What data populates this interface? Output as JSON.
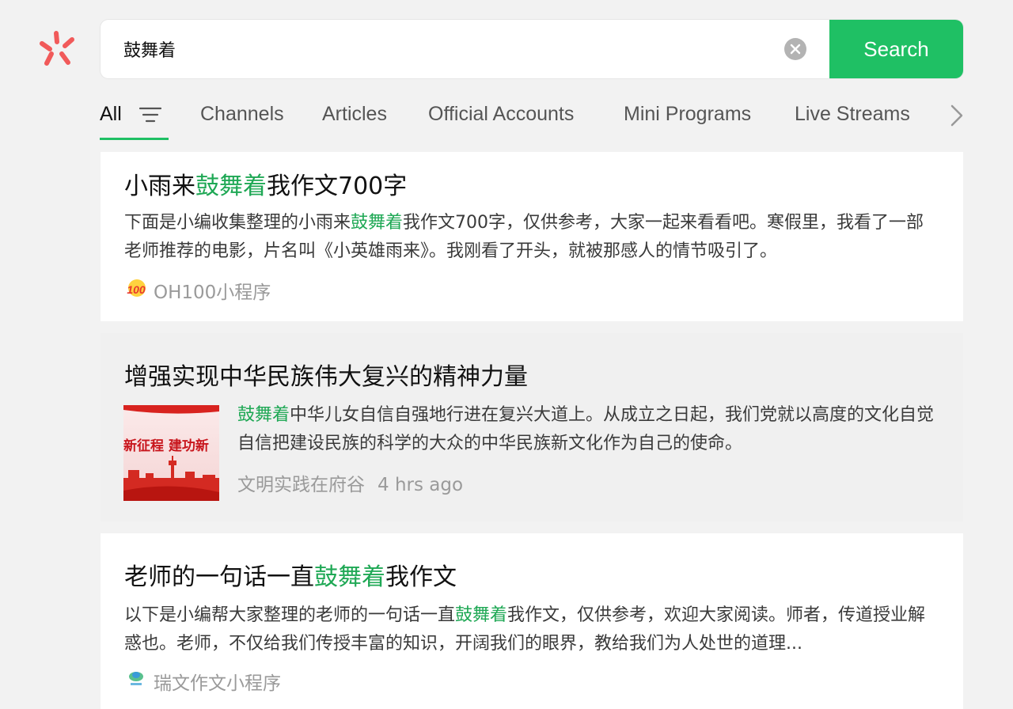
{
  "search": {
    "query": "鼓舞着",
    "button_label": "Search"
  },
  "tabs": [
    {
      "label": "All"
    },
    {
      "label": "Channels"
    },
    {
      "label": "Articles"
    },
    {
      "label": "Official Accounts"
    },
    {
      "label": "Mini Programs"
    },
    {
      "label": "Live Streams"
    }
  ],
  "results": [
    {
      "title_pre": "小雨来",
      "title_hl": "鼓舞着",
      "title_post": "我作文700字",
      "desc_pre": "下面是小编收集整理的小雨来",
      "desc_hl": "鼓舞着",
      "desc_post": "我作文700字，仅供参考，大家一起来看看吧。寒假里，我看了一部老师推荐的电影，片名叫《小英雄雨来》。我刚看了开头，就被那感人的情节吸引了。",
      "source": "OH100小程序",
      "source_icon_text": "100"
    },
    {
      "title": "增强实现中华民族伟大复兴的精神力量",
      "desc_hl": "鼓舞着",
      "desc_post": "中华儿女自信自强地行进在复兴大道上。从成立之日起，我们党就以高度的文化自觉自信把建设民族的科学的大众的中华民族新文化作为自己的使命。",
      "source": "文明实践在府谷",
      "time": "4 hrs ago",
      "thumb_text": "新征程  建功新"
    },
    {
      "title_pre": "老师的一句话一直",
      "title_hl": "鼓舞着",
      "title_post": "我作文",
      "desc_pre": "以下是小编帮大家整理的老师的一句话一直",
      "desc_hl": "鼓舞着",
      "desc_post": "我作文，仅供参考，欢迎大家阅读。师者，传道授业解惑也。老师，不仅给我们传授丰富的知识，开阔我们的眼界，教给我们为人处世的道理...",
      "source": "瑞文作文小程序"
    }
  ],
  "colors": {
    "accent": "#1fc064",
    "highlight": "#1fa855",
    "logo": "#f15a5a"
  }
}
